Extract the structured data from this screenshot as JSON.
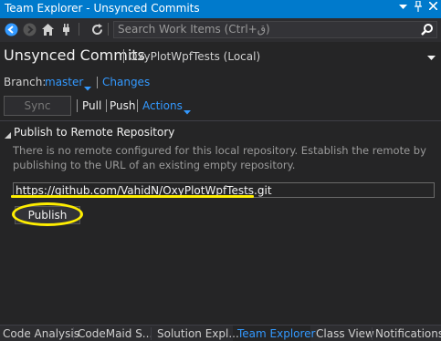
{
  "window": {
    "title": "Team Explorer - Unsynced Commits",
    "dropdown_glyph": "▾",
    "pin_glyph": "📌",
    "close_glyph": "✕"
  },
  "toolbar": {
    "icons": [
      "back-icon",
      "forward-icon",
      "home-icon",
      "plug-icon",
      "refresh-icon"
    ],
    "search_placeholder": "Search Work Items (Ctrl+ق)"
  },
  "header": {
    "title": "Unsynced Commits",
    "repo": "OxyPlotWpfTests (Local)"
  },
  "branch": {
    "label": "Branch:",
    "name": "master",
    "changes_link": "Changes"
  },
  "actions": {
    "sync": "Sync",
    "pull": "Pull",
    "push": "Push",
    "actions": "Actions"
  },
  "publish_section": {
    "title": "Publish to Remote Repository",
    "message": "There is no remote configured for this local repository. Establish the remote by publishing to the URL of an existing empty repository.",
    "url_value": "https://github.com/VahidN/OxyPlotWpfTests.git",
    "publish_button": "Publish"
  },
  "bottom_tabs": [
    "Code Analysis",
    "CodeMaid S...",
    "Solution Expl...",
    "Team Explorer",
    "Class View",
    "Notifications"
  ],
  "colors": {
    "accent": "#007acc",
    "link": "#3399ff",
    "highlight": "#ffee00",
    "background": "#252526"
  }
}
